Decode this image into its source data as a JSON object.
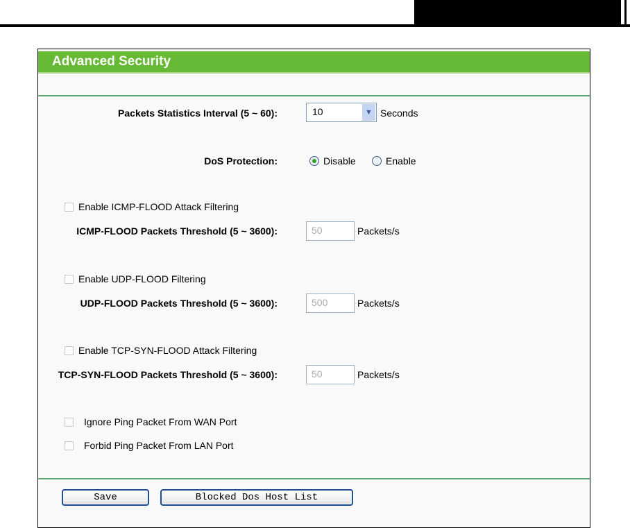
{
  "title": "Advanced Security",
  "interval": {
    "label": "Packets Statistics Interval (5 ~ 60):",
    "value": "10",
    "unit": "Seconds"
  },
  "dos": {
    "label": "DoS Protection:",
    "options": [
      "Disable",
      "Enable"
    ],
    "selected": "Disable"
  },
  "icmp": {
    "checkbox": "Enable ICMP-FLOOD Attack Filtering",
    "label": "ICMP-FLOOD Packets Threshold (5 ~ 3600):",
    "value": "50",
    "unit": "Packets/s"
  },
  "udp": {
    "checkbox": "Enable UDP-FLOOD Filtering",
    "label": "UDP-FLOOD Packets Threshold (5 ~ 3600):",
    "value": "500",
    "unit": "Packets/s"
  },
  "tcp": {
    "checkbox": "Enable TCP-SYN-FLOOD Attack Filtering",
    "label": "TCP-SYN-FLOOD Packets Threshold (5 ~ 3600):",
    "value": "50",
    "unit": "Packets/s"
  },
  "ping": {
    "wan": "Ignore Ping Packet From WAN Port",
    "lan": "Forbid Ping Packet From LAN Port"
  },
  "buttons": {
    "save": "Save",
    "blocked": "Blocked Dos Host List"
  },
  "colors": {
    "header": "#66b934",
    "separator": "#5ea876"
  }
}
